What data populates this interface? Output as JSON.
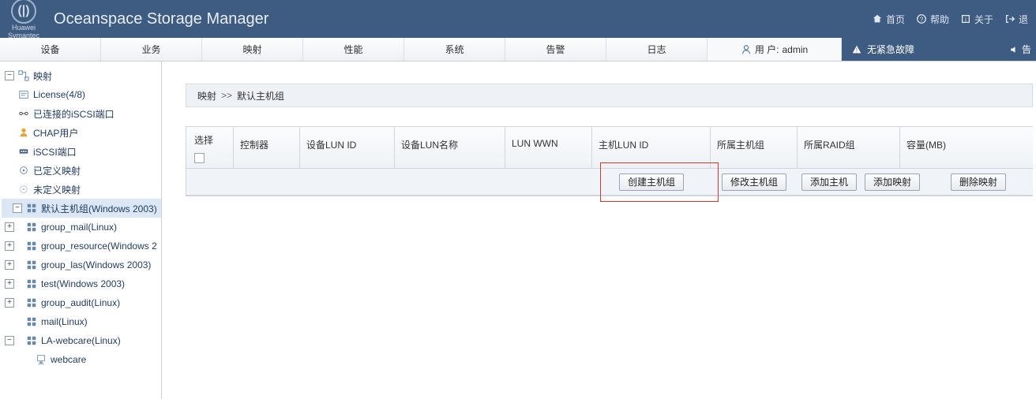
{
  "header": {
    "brand_top": "Huawei",
    "brand_bottom": "Symantec",
    "title": "Oceanspace Storage Manager",
    "links": {
      "home": "首页",
      "help": "帮助",
      "about": "关于",
      "logout": "退"
    }
  },
  "menu": {
    "items": [
      "设备",
      "业务",
      "映射",
      "性能",
      "系统",
      "告警",
      "日志"
    ],
    "user_prefix": "用 户:",
    "user_name": "admin",
    "alert_text": "无紧急故障",
    "alert2_text": "告"
  },
  "tree": {
    "root": "映射",
    "items": [
      {
        "label": "License(4/8)",
        "icon": "license"
      },
      {
        "label": "已连接的iSCSI端口",
        "icon": "iscsi-conn"
      },
      {
        "label": "CHAP用户",
        "icon": "user"
      },
      {
        "label": "iSCSI端口",
        "icon": "port"
      },
      {
        "label": "已定义映射",
        "icon": "map"
      },
      {
        "label": "未定义映射",
        "icon": "map"
      }
    ],
    "groups": [
      {
        "label": "默认主机组(Windows 2003)",
        "selected": true,
        "exp": "-"
      },
      {
        "label": "group_mail(Linux)",
        "exp": "+"
      },
      {
        "label": "group_resource(Windows 2",
        "exp": "+"
      },
      {
        "label": "group_las(Windows 2003)",
        "exp": "+"
      },
      {
        "label": "test(Windows 2003)",
        "exp": "+"
      },
      {
        "label": "group_audit(Linux)",
        "exp": "+"
      },
      {
        "label": "mail(Linux)",
        "exp": ""
      },
      {
        "label": "LA-webcare(Linux)",
        "exp": "-"
      }
    ],
    "child": "webcare"
  },
  "breadcrumb": {
    "a": "映射",
    "sep": ">>",
    "b": "默认主机组"
  },
  "table": {
    "headers": {
      "select": "选择",
      "controller": "控制器",
      "dev_lun_id": "设备LUN ID",
      "dev_lun_name": "设备LUN名称",
      "lun_wwn": "LUN WWN",
      "host_lun_id": "主机LUN ID",
      "host_group": "所属主机组",
      "raid_group": "所属RAID组",
      "capacity": "容量(MB)"
    },
    "buttons": {
      "create_hg": "创建主机组",
      "modify_hg": "修改主机组",
      "add_host": "添加主机",
      "add_map": "添加映射",
      "del_map": "删除映射"
    }
  }
}
